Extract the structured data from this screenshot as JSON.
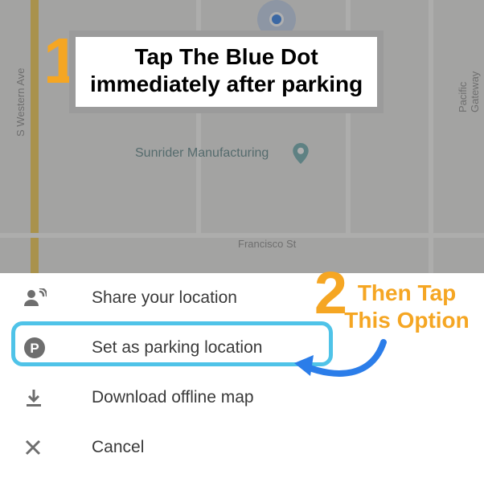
{
  "map": {
    "streets": {
      "western": "S Western Ave",
      "francisco": "Francisco St",
      "pacific_gateway": "Pacific Gateway"
    },
    "poi": {
      "sunrider": "Sunrider Manufacturing"
    }
  },
  "instruction": {
    "step1_number": "1",
    "line1": "Tap The Blue Dot",
    "line2": "immediately after parking",
    "step2_number": "2",
    "step2_line1": "Then Tap",
    "step2_line2": "This Option"
  },
  "sheet": {
    "share": "Share your location",
    "parking": "Set as parking location",
    "download": "Download offline map",
    "cancel": "Cancel"
  },
  "colors": {
    "accent_orange": "#f5a623",
    "highlight_blue": "#4fc3e8",
    "user_dot": "#2b7de9"
  }
}
